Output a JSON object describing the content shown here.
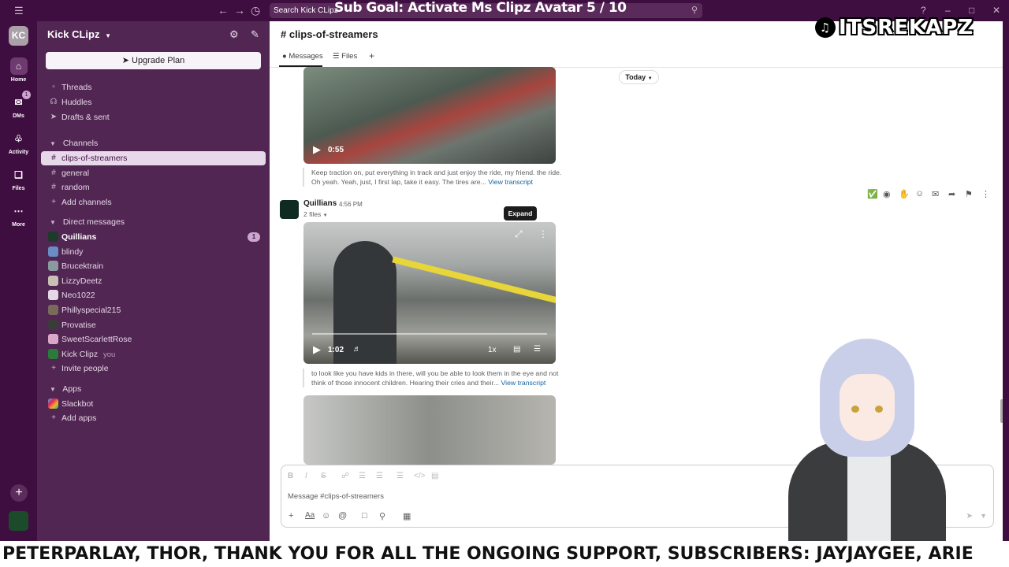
{
  "topbar": {
    "search_placeholder": "Search Kick CLipz",
    "stream_overlay": "Sub Goal: Activate Ms Clipz Avatar  5 / 10"
  },
  "rail": {
    "workspace_initials": "KC",
    "items": [
      {
        "label": "Home",
        "icon": "home-icon"
      },
      {
        "label": "DMs",
        "icon": "dms-icon",
        "badge": "1"
      },
      {
        "label": "Activity",
        "icon": "bell-icon"
      },
      {
        "label": "Files",
        "icon": "files-icon"
      },
      {
        "label": "More",
        "icon": "more-icon"
      }
    ]
  },
  "sidebar": {
    "workspace_name": "Kick CLipz",
    "upgrade_label": "Upgrade Plan",
    "nav": [
      {
        "label": "Threads",
        "icon": "threads-icon"
      },
      {
        "label": "Huddles",
        "icon": "headphones-icon"
      },
      {
        "label": "Drafts & sent",
        "icon": "send-icon"
      }
    ],
    "channels_header": "Channels",
    "channels": [
      "clips-of-streamers",
      "general",
      "random"
    ],
    "add_channels": "Add channels",
    "dm_header": "Direct messages",
    "dms": [
      {
        "name": "Quillians",
        "count": "1",
        "color": "#1c3b2a"
      },
      {
        "name": "blindy",
        "color": "#6a8cc4"
      },
      {
        "name": "Brucektrain",
        "color": "#8a9aa0"
      },
      {
        "name": "LizzyDeetz",
        "color": "#c9c0b5"
      },
      {
        "name": "Neo1022",
        "color": "#e5d7e6"
      },
      {
        "name": "Phillyspecial215",
        "color": "#7a6a5c"
      },
      {
        "name": "Provatise",
        "color": "#3b3b3b"
      },
      {
        "name": "SweetScarlettRose",
        "color": "#d9a7c7"
      },
      {
        "name": "Kick Clipz",
        "suffix": "you",
        "color": "#2a7a3a"
      }
    ],
    "invite": "Invite people",
    "apps_header": "Apps",
    "apps": [
      "Slackbot"
    ],
    "add_apps": "Add apps"
  },
  "channel": {
    "title": "# clips-of-streamers",
    "tabs": [
      "Messages",
      "Files"
    ],
    "date_divider": "Today",
    "video1": {
      "duration": "0:55"
    },
    "caption1_text": "Keep traction on, put everything in track and just enjoy the ride, my friend. the ride. Oh yeah. Yeah, just, I first lap, take it easy. The tires are...",
    "caption_link": "View transcript",
    "message": {
      "author": "Quillians",
      "time": "4:56 PM",
      "files": "2 files"
    },
    "expand_tooltip": "Expand",
    "video2": {
      "duration": "1:02",
      "speed": "1x"
    },
    "caption2_text": "to look like you have kids in there, will you be able to look them in the eye and not think of those innocent children. Hearing their cries and their...",
    "composer_placeholder": "Message #clips-of-streamers"
  },
  "overlay": {
    "tiktok_handle": "ITSREKAPZ",
    "ticker": "PETERPARLAY, THOR, THANK YOU FOR ALL THE ONGOING SUPPORT, SUBSCRIBERS: JAYJAYGEE, ARIE"
  },
  "colors": {
    "aubergine": "#3f0e40",
    "sidebar": "#522653",
    "link": "#1264a3"
  }
}
